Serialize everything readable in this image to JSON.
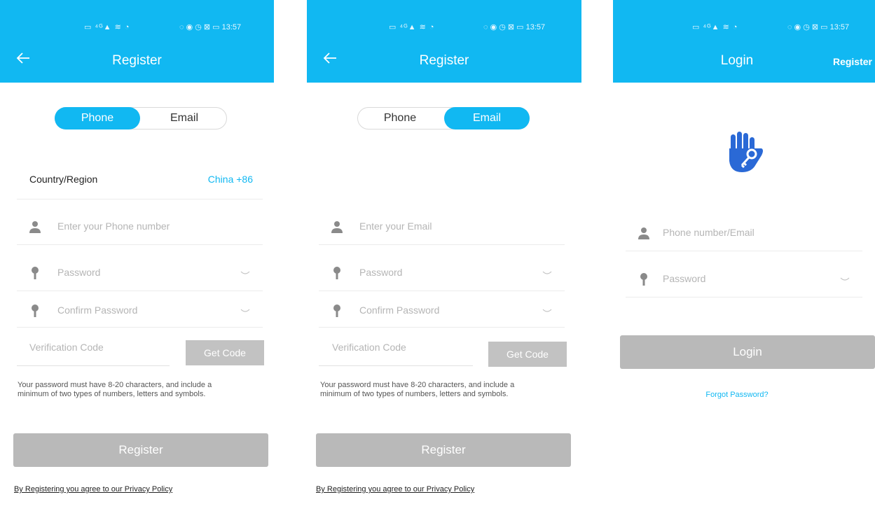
{
  "status": {
    "left": "▭ ⁴ᴳ▲ ≋ ◔",
    "right": "◌ ◉ ◷ ⊠ ▭ 13:57"
  },
  "colors": {
    "accent": "#11b8f2",
    "button_disabled": "#b9b9b9"
  },
  "register_phone": {
    "title": "Register",
    "tabs": [
      "Phone",
      "Email"
    ],
    "active_tab": "Phone",
    "country_label": "Country/Region",
    "country_value": "China +86",
    "phone_placeholder": "Enter your Phone number",
    "password_placeholder": "Password",
    "confirm_placeholder": "Confirm Password",
    "code_placeholder": "Verification Code",
    "get_code": "Get Code",
    "hint_line1": "Your password must have 8-20 characters, and include a",
    "hint_line2": "minimum of two types of numbers, letters and symbols.",
    "register_button": "Register",
    "policy": "By Registering you agree to our Privacy Policy"
  },
  "register_email": {
    "title": "Register",
    "tabs": [
      "Phone",
      "Email"
    ],
    "active_tab": "Email",
    "email_placeholder": "Enter your Email",
    "password_placeholder": "Password",
    "confirm_placeholder": "Confirm Password",
    "code_placeholder": "Verification Code",
    "get_code": "Get Code",
    "hint_line1": "Your password must have 8-20 characters, and include a",
    "hint_line2": "minimum of two types of numbers, letters and symbols.",
    "register_button": "Register",
    "policy": "By Registering you agree to our Privacy Policy"
  },
  "login": {
    "title": "Login",
    "register_link": "Register",
    "account_placeholder": "Phone number/Email",
    "password_placeholder": "Password",
    "login_button": "Login",
    "forgot": "Forgot Password?"
  }
}
